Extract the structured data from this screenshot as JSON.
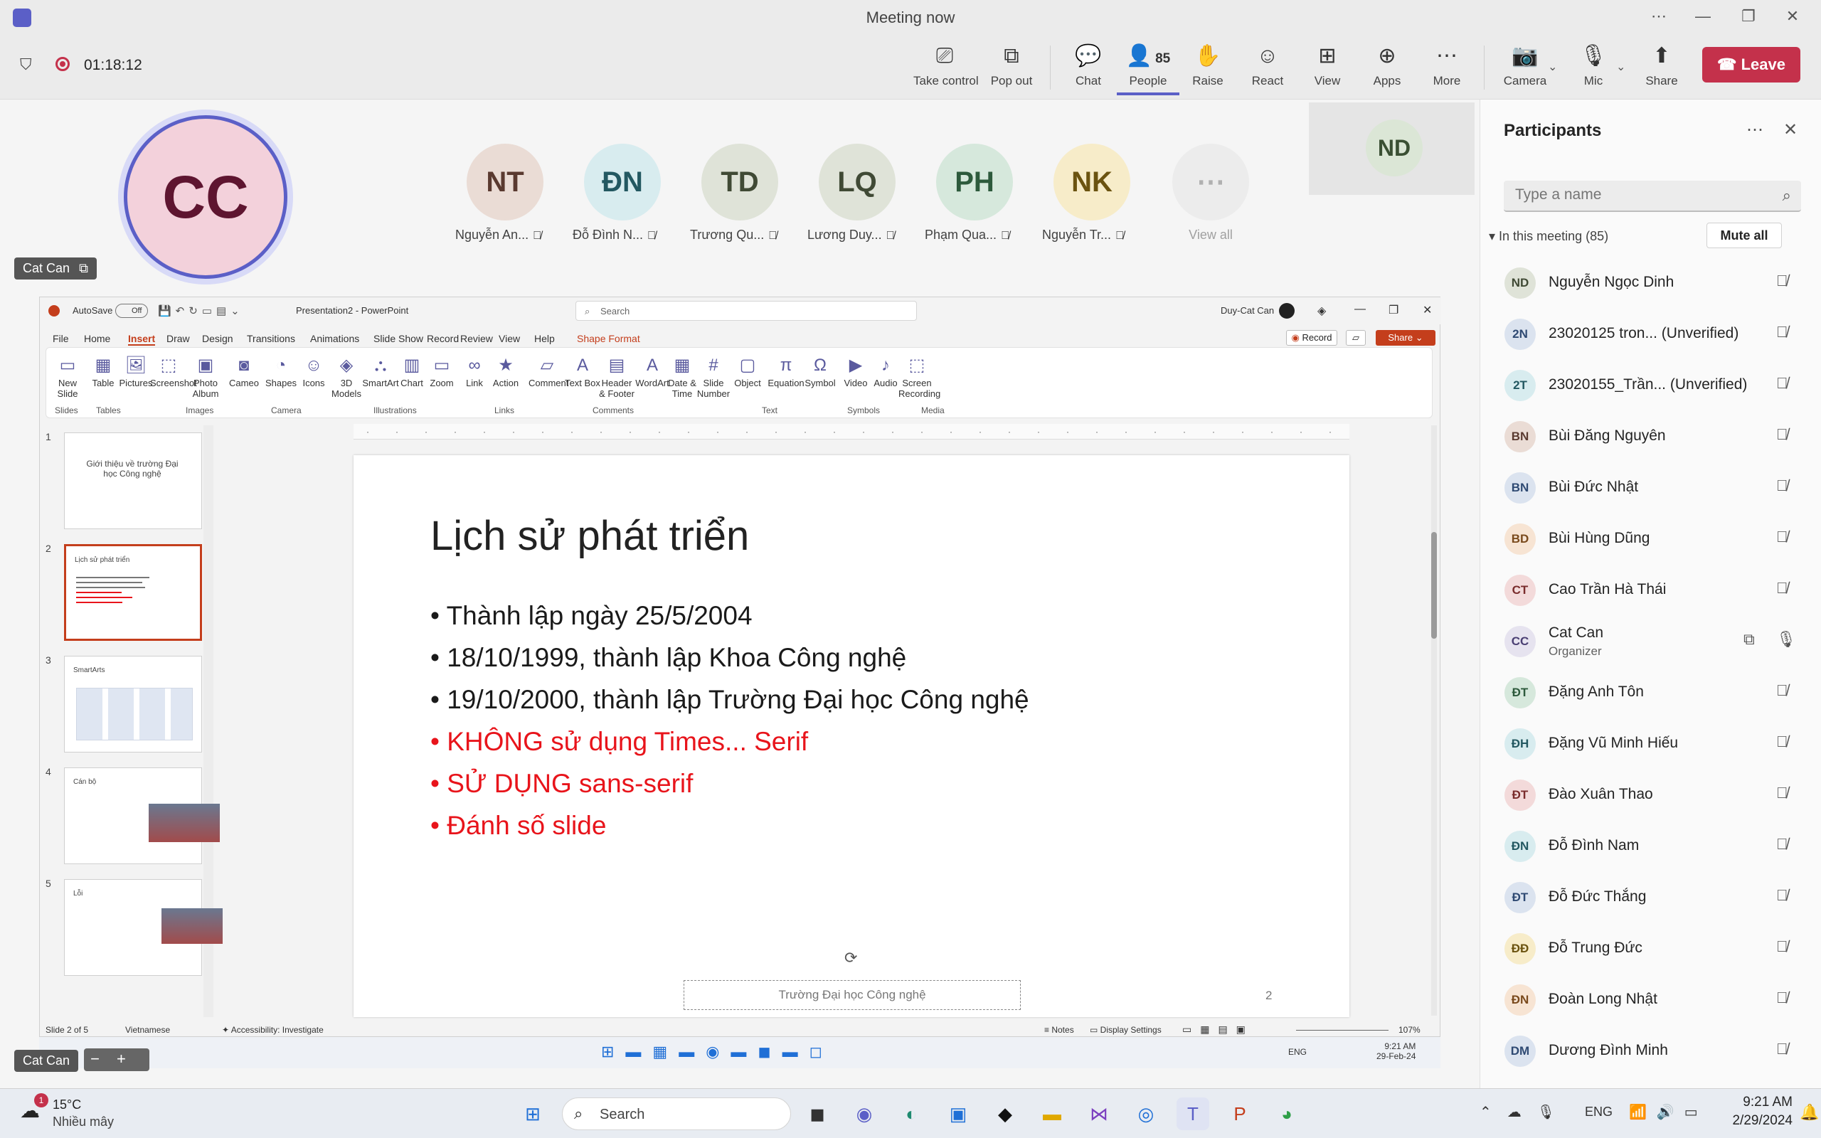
{
  "window": {
    "title": "Meeting now"
  },
  "meeting": {
    "timer": "01:18:12"
  },
  "toolbar": {
    "take_control": "Take control",
    "pop_out": "Pop out",
    "chat": "Chat",
    "people": "People",
    "people_count": "85",
    "raise": "Raise",
    "react": "React",
    "view": "View",
    "apps": "Apps",
    "more": "More",
    "camera": "Camera",
    "mic": "Mic",
    "share": "Share",
    "leave": "Leave"
  },
  "stage": {
    "presenter_initials": "CC",
    "presenter_chip": "Cat Can",
    "presenter_chip_bottom": "Cat Can",
    "attendees": [
      {
        "initials": "NT",
        "name": "Nguyễn An...",
        "bg": "#eadcd5",
        "fg": "#5a3a30"
      },
      {
        "initials": "ĐN",
        "name": "Đỗ Đình N...",
        "bg": "#d8ecef",
        "fg": "#235861"
      },
      {
        "initials": "TD",
        "name": "Trương Qu...",
        "bg": "#dfe3d8",
        "fg": "#404a35"
      },
      {
        "initials": "LQ",
        "name": "Lương Duy...",
        "bg": "#dfe3d8",
        "fg": "#404a35"
      },
      {
        "initials": "PH",
        "name": "Phạm Qua...",
        "bg": "#d6e8dc",
        "fg": "#2d5a3c"
      },
      {
        "initials": "NK",
        "name": "Nguyễn Tr...",
        "bg": "#f7ecc9",
        "fg": "#6b5310"
      }
    ],
    "view_all": "View all",
    "nd_initials": "ND"
  },
  "participants": {
    "title": "Participants",
    "search_placeholder": "Type a name",
    "in_meeting": "In this meeting (85)",
    "mute_all": "Mute all",
    "list": [
      {
        "initials": "ND",
        "name": "Nguyễn Ngọc Dinh",
        "bg": "#dfe3d8",
        "fg": "#404a35"
      },
      {
        "initials": "2N",
        "name": "23020125 tron... (Unverified)",
        "bg": "#dbe3ef",
        "fg": "#2f4a73"
      },
      {
        "initials": "2T",
        "name": "23020155_Trần... (Unverified)",
        "bg": "#d8ecef",
        "fg": "#235861"
      },
      {
        "initials": "BN",
        "name": "Bùi Đăng Nguyên",
        "bg": "#eadcd5",
        "fg": "#5a3a30"
      },
      {
        "initials": "BN",
        "name": "Bùi Đức Nhật",
        "bg": "#dbe3ef",
        "fg": "#2f4a73"
      },
      {
        "initials": "BD",
        "name": "Bùi Hùng Dũng",
        "bg": "#f7e4d3",
        "fg": "#7a4a1c"
      },
      {
        "initials": "CT",
        "name": "Cao Trần Hà Thái",
        "bg": "#f3dada",
        "fg": "#7a2c2c"
      },
      {
        "initials": "CC",
        "name": "Cat Can",
        "sub": "Organizer",
        "bg": "#e6e3ef",
        "fg": "#4a3f73"
      },
      {
        "initials": "ĐT",
        "name": "Đặng Anh Tôn",
        "bg": "#d6e8dc",
        "fg": "#2d5a3c"
      },
      {
        "initials": "ĐH",
        "name": "Đặng Vũ Minh Hiếu",
        "bg": "#d8ecef",
        "fg": "#235861"
      },
      {
        "initials": "ĐT",
        "name": "Đào Xuân Thao",
        "bg": "#f3dada",
        "fg": "#7a2c2c"
      },
      {
        "initials": "ĐN",
        "name": "Đỗ Đình Nam",
        "bg": "#d8ecef",
        "fg": "#235861"
      },
      {
        "initials": "ĐT",
        "name": "Đỗ Đức Thắng",
        "bg": "#dbe3ef",
        "fg": "#2f4a73"
      },
      {
        "initials": "ĐĐ",
        "name": "Đỗ Trung Đức",
        "bg": "#f7ecc9",
        "fg": "#6b5310"
      },
      {
        "initials": "ĐN",
        "name": "Đoàn Long Nhật",
        "bg": "#f7e4d3",
        "fg": "#7a4a1c"
      },
      {
        "initials": "DM",
        "name": "Dương Đình Minh",
        "bg": "#dbe3ef",
        "fg": "#2f4a73"
      }
    ]
  },
  "ppt": {
    "autosave": "AutoSave",
    "autosave_state": "Off",
    "doc_title": "Presentation2 - PowerPoint",
    "search": "Search",
    "user": "Duy-Cat Can",
    "record_btn": "Record",
    "share_btn": "Share",
    "tabs": [
      "File",
      "Home",
      "Insert",
      "Draw",
      "Design",
      "Transitions",
      "Animations",
      "Slide Show",
      "Record",
      "Review",
      "View",
      "Help",
      "Shape Format"
    ],
    "ribbon": [
      {
        "label": "New Slide",
        "icon": "▭"
      },
      {
        "label": "Table",
        "icon": "▦"
      },
      {
        "label": "Pictures",
        "icon": "🖼"
      },
      {
        "label": "Screenshot",
        "icon": "⬚"
      },
      {
        "label": "Photo Album",
        "icon": "▣"
      },
      {
        "label": "Cameo",
        "icon": "◙"
      },
      {
        "label": "Shapes",
        "icon": "◔"
      },
      {
        "label": "Icons",
        "icon": "☺"
      },
      {
        "label": "3D Models",
        "icon": "◈"
      },
      {
        "label": "SmartArt",
        "icon": "⛬"
      },
      {
        "label": "Chart",
        "icon": "▥"
      },
      {
        "label": "Zoom",
        "icon": "▭"
      },
      {
        "label": "Link",
        "icon": "∞"
      },
      {
        "label": "Action",
        "icon": "★"
      },
      {
        "label": "Comment",
        "icon": "▱"
      },
      {
        "label": "Text Box",
        "icon": "A"
      },
      {
        "label": "Header & Footer",
        "icon": "▤"
      },
      {
        "label": "WordArt",
        "icon": "A"
      },
      {
        "label": "Date & Time",
        "icon": "▦"
      },
      {
        "label": "Slide Number",
        "icon": "#"
      },
      {
        "label": "Object",
        "icon": "▢"
      },
      {
        "label": "Equation",
        "icon": "π"
      },
      {
        "label": "Symbol",
        "icon": "Ω"
      },
      {
        "label": "Video",
        "icon": "▶"
      },
      {
        "label": "Audio",
        "icon": "♪"
      },
      {
        "label": "Screen Recording",
        "icon": "⬚"
      }
    ],
    "groups": [
      "Slides",
      "Tables",
      "Images",
      "Camera",
      "Illustrations",
      "Links",
      "Comments",
      "Text",
      "Symbols",
      "Media"
    ],
    "thumbs": [
      {
        "num": "1",
        "text": "Giới thiệu về trường Đại học Công nghệ"
      },
      {
        "num": "2",
        "text": "Lịch sử phát triển"
      },
      {
        "num": "3",
        "text": "SmartArts"
      },
      {
        "num": "4",
        "text": "Cán bộ"
      },
      {
        "num": "5",
        "text": "Lỗi"
      }
    ],
    "slide": {
      "title": "Lịch sử phát triển",
      "bullets": [
        {
          "text": "Thành lập ngày 25/5/2004",
          "color": "#1a1a1a"
        },
        {
          "text": "18/10/1999, thành lập Khoa Công nghệ",
          "color": "#1a1a1a"
        },
        {
          "text": "19/10/2000, thành lập Trường Đại học Công nghệ",
          "color": "#1a1a1a"
        },
        {
          "text": "KHÔNG sử dụng Times... Serif",
          "color": "#e8141b"
        },
        {
          "text": "SỬ DỤNG sans-serif",
          "color": "#e8141b"
        },
        {
          "text": "Đánh số slide",
          "color": "#e8141b"
        }
      ],
      "footer": "Trường Đại học Công nghệ",
      "number": "2"
    },
    "status": {
      "slide_of": "Slide 2 of 5",
      "language": "Vietnamese",
      "accessibility": "Accessibility: Investigate",
      "notes": "Notes",
      "display": "Display Settings",
      "zoom": "107%"
    }
  },
  "taskbar": {
    "weather_temp": "15°C",
    "weather_desc": "Nhiều mây",
    "search": "Search",
    "lang": "ENG",
    "time": "9:21 AM",
    "date": "2/29/2024",
    "inner_time": "9:21 AM",
    "inner_date": "29-Feb-24"
  },
  "colors": {
    "accent": "#5b5fc7",
    "leave": "#c4314b",
    "ppt_accent": "#c43e1c"
  }
}
